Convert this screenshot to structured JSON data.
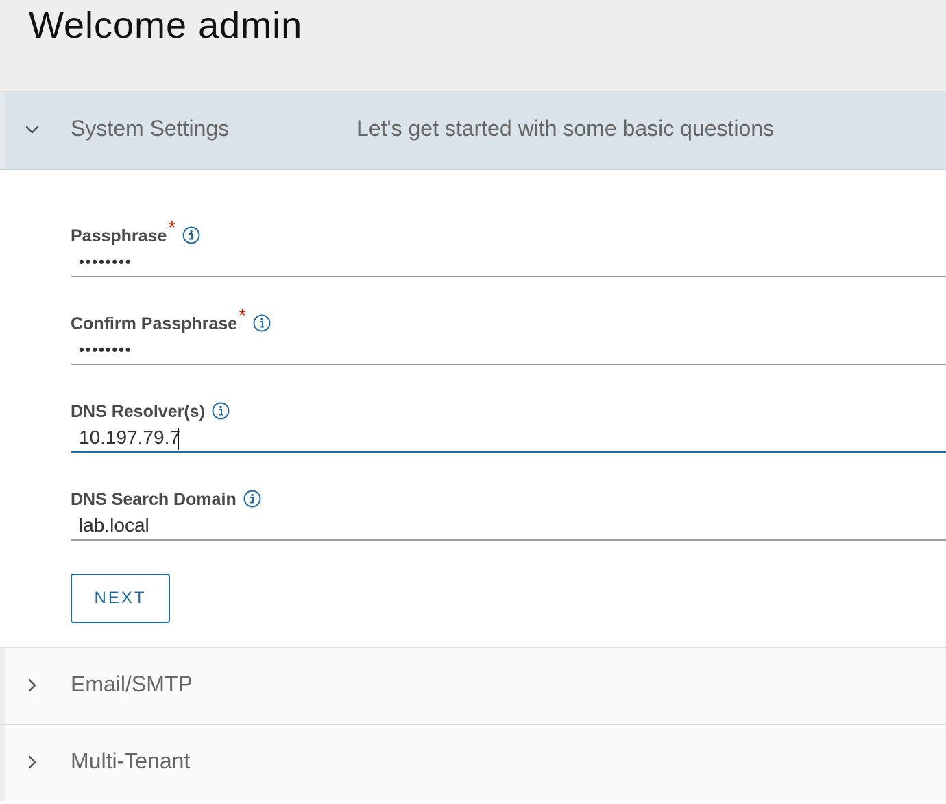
{
  "page": {
    "title": "Welcome admin"
  },
  "steps": [
    {
      "title": "System Settings",
      "description": "Let's get started with some basic questions",
      "expanded": true,
      "fields": [
        {
          "label": "Passphrase",
          "required": true,
          "value": "••••••••",
          "type": "password"
        },
        {
          "label": "Confirm Passphrase",
          "required": true,
          "value": "••••••••",
          "type": "password"
        },
        {
          "label": "DNS Resolver(s)",
          "required": false,
          "value": "10.197.79.7",
          "focused": true
        },
        {
          "label": "DNS Search Domain",
          "required": false,
          "value": "lab.local"
        }
      ],
      "next_label": "NEXT",
      "required_marker": "*"
    },
    {
      "title": "Email/SMTP",
      "expanded": false
    },
    {
      "title": "Multi-Tenant",
      "expanded": false
    }
  ],
  "colors": {
    "accent": "#1f6aa5",
    "required": "#c92100",
    "active_header_bg": "#dbe3ea",
    "page_header_bg": "#eeeeee"
  },
  "icons": {
    "expanded": "chevron-down-icon",
    "collapsed": "chevron-right-icon",
    "info": "info-icon"
  }
}
